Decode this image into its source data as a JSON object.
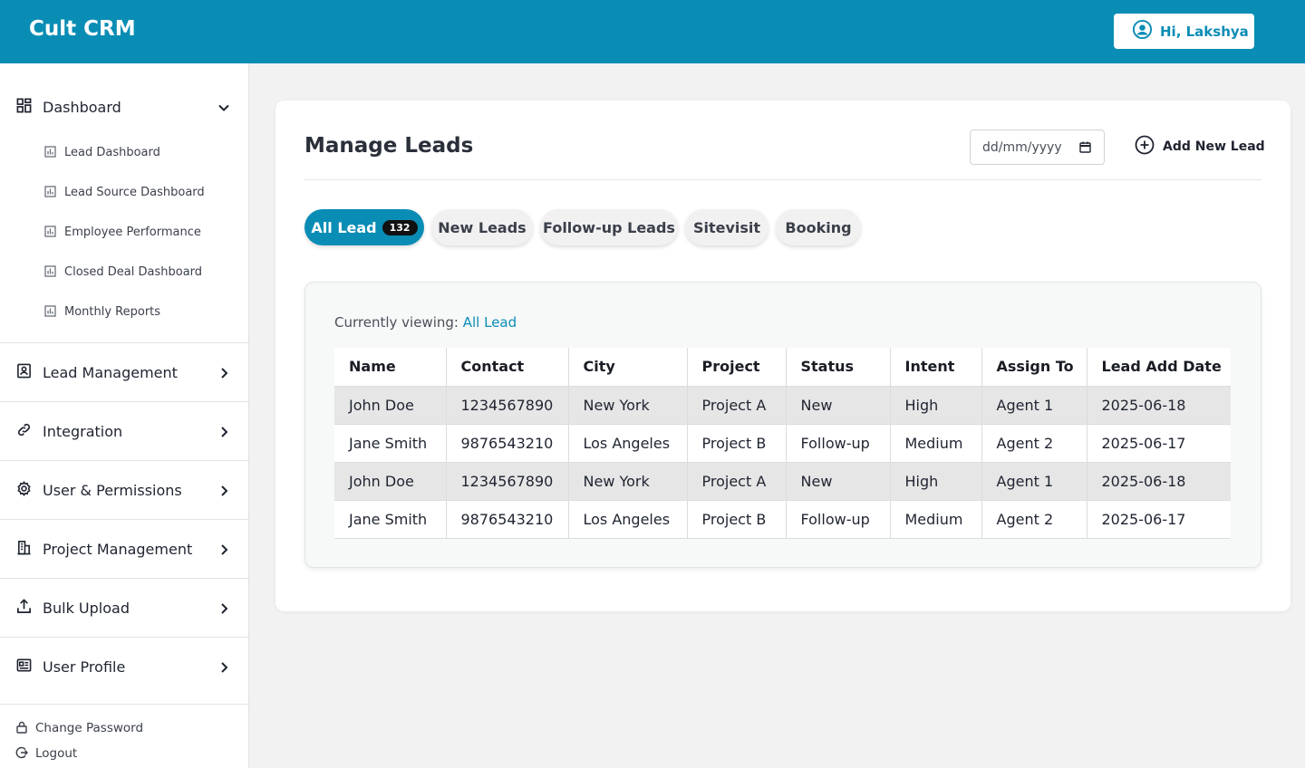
{
  "app": {
    "title": "Cult CRM",
    "greeting": "Hi, Lakshya"
  },
  "colors": {
    "brand": "#0a8db5",
    "active_tab": "#0a8db5",
    "badge": "#111111"
  },
  "sidebar": {
    "dashboard": {
      "label": "Dashboard",
      "icon": "dashboard-grid-icon",
      "expanded": true,
      "items": [
        {
          "label": "Lead Dashboard",
          "icon": "chart-icon"
        },
        {
          "label": "Lead Source Dashboard",
          "icon": "chart-icon"
        },
        {
          "label": "Employee Performance",
          "icon": "chart-icon"
        },
        {
          "label": "Closed Deal Dashboard",
          "icon": "chart-icon"
        },
        {
          "label": "Monthly Reports",
          "icon": "chart-icon"
        }
      ]
    },
    "menu": [
      {
        "label": "Lead Management",
        "icon": "contact-book-icon"
      },
      {
        "label": "Integration",
        "icon": "link-icon"
      },
      {
        "label": "User & Permissions",
        "icon": "gear-icon"
      },
      {
        "label": "Project Management",
        "icon": "building-icon"
      },
      {
        "label": "Bulk Upload",
        "icon": "upload-icon"
      },
      {
        "label": "User Profile",
        "icon": "profile-card-icon"
      }
    ],
    "footer": [
      {
        "label": "Change Password",
        "icon": "lock-icon"
      },
      {
        "label": "Logout",
        "icon": "logout-icon"
      }
    ]
  },
  "main": {
    "title": "Manage Leads",
    "date_placeholder": "dd/mm/yyyy",
    "add_label": "Add New Lead",
    "tabs": [
      {
        "label": "All Lead",
        "badge": "132",
        "active": true
      },
      {
        "label": "New Leads"
      },
      {
        "label": "Follow-up Leads"
      },
      {
        "label": "Sitevisit"
      },
      {
        "label": "Booking"
      }
    ],
    "viewing_prefix": "Currently viewing:",
    "viewing_value": "All Lead",
    "table": {
      "headers": [
        "Name",
        "Contact",
        "City",
        "Project",
        "Status",
        "Intent",
        "Assign To",
        "Lead Add Date"
      ],
      "rows": [
        [
          "John Doe",
          "1234567890",
          "New York",
          "Project A",
          "New",
          "High",
          "Agent 1",
          "2025-06-18"
        ],
        [
          "Jane Smith",
          "9876543210",
          "Los Angeles",
          "Project B",
          "Follow-up",
          "Medium",
          "Agent 2",
          "2025-06-17"
        ],
        [
          "John Doe",
          "1234567890",
          "New York",
          "Project A",
          "New",
          "High",
          "Agent 1",
          "2025-06-18"
        ],
        [
          "Jane Smith",
          "9876543210",
          "Los Angeles",
          "Project B",
          "Follow-up",
          "Medium",
          "Agent 2",
          "2025-06-17"
        ]
      ]
    }
  }
}
